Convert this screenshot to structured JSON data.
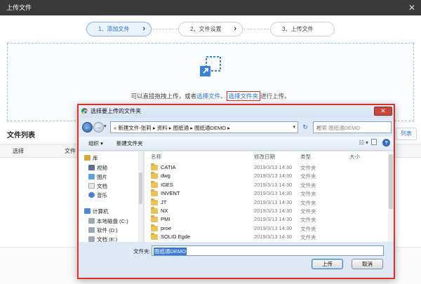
{
  "dialog": {
    "title": "上传文件",
    "close": "✕"
  },
  "steps": [
    {
      "label": "1、添加文件",
      "chevron": "›"
    },
    {
      "label": "2、文件设置",
      "chevron": "›"
    },
    {
      "label": "3、上传文件"
    }
  ],
  "dropzone": {
    "text_prefix": "可以直接拖拽上传，或者",
    "link_files": "选择文件",
    "sep": "、",
    "link_folder": "选择文件夹",
    "text_suffix": "进行上传。"
  },
  "file_list": {
    "title": "文件列表",
    "col_select": "选择",
    "col_file": "文件",
    "right_button": "列表"
  },
  "picker": {
    "title": "选择要上传的文件夹",
    "close": "✕",
    "back": "←",
    "forward": "→",
    "address": "« 新建文件-张莉 ▸ 资料 ▸ 图纸通 ▸ 图纸通DEMO ▸",
    "address_dropdown": "▾",
    "refresh": "↻",
    "search_placeholder": "搜索 图纸通DEMO",
    "search_icon": "magnifier-icon",
    "organize": "组织 ▾",
    "new_folder": "新建文件夹",
    "view": "☷ ▾",
    "help": "?",
    "nav_items": [
      {
        "label": "库",
        "icon": "library-icon"
      },
      {
        "label": "视频",
        "icon": "video-icon"
      },
      {
        "label": "图片",
        "icon": "picture-icon"
      },
      {
        "label": "文档",
        "icon": "document-icon"
      },
      {
        "label": "音乐",
        "icon": "music-icon"
      },
      {
        "label": "计算机",
        "icon": "computer-icon"
      },
      {
        "label": "本地磁盘 (C:)",
        "icon": "drive-icon"
      },
      {
        "label": "软件 (D:)",
        "icon": "drive-icon"
      },
      {
        "label": "文档 (E:)",
        "icon": "drive-icon"
      }
    ],
    "columns": {
      "name": "名称",
      "date": "修改日期",
      "type": "类型",
      "size": "大小"
    },
    "files": [
      {
        "name": "CATIA",
        "date": "2019/3/13 14:30",
        "type": "文件夹"
      },
      {
        "name": "dwg",
        "date": "2019/3/13 14:30",
        "type": "文件夹"
      },
      {
        "name": "IGES",
        "date": "2019/3/13 14:30",
        "type": "文件夹"
      },
      {
        "name": "INVENT",
        "date": "2019/3/13 14:30",
        "type": "文件夹"
      },
      {
        "name": "JT",
        "date": "2019/3/13 14:30",
        "type": "文件夹"
      },
      {
        "name": "NX",
        "date": "2019/3/13 14:30",
        "type": "文件夹"
      },
      {
        "name": "PMI",
        "date": "2019/3/13 14:30",
        "type": "文件夹"
      },
      {
        "name": "proe",
        "date": "2019/3/13 14:30",
        "type": "文件夹"
      },
      {
        "name": "SOLID Egde",
        "date": "2019/3/13 14:30",
        "type": "文件夹"
      }
    ],
    "folder_label": "文件夹:",
    "folder_value": "图纸通DEMO",
    "upload_button": "上传",
    "cancel_button": "取消"
  }
}
